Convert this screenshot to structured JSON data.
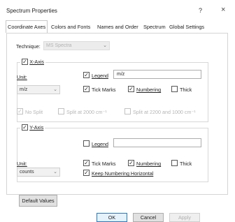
{
  "window": {
    "title": "Spectrum Properties",
    "help": "?",
    "close": "×"
  },
  "tabs": [
    "Coordinate Axes",
    "Colors and Fonts",
    "Names and Order",
    "Spectrum",
    "Global Settings"
  ],
  "technique": {
    "label": "Technique:",
    "value": "MS Spectra"
  },
  "x_axis": {
    "title": "X-Axis",
    "checked": true,
    "unit_label": "Unit:",
    "unit_value": "m/z",
    "legend_label": "Legend",
    "legend_value": "m/z",
    "tick_marks": "Tick Marks",
    "numbering": "Numbering",
    "thick": "Thick",
    "no_split": "No Split",
    "split_2000": "Split at 2000 cm⁻¹",
    "split_2200": "Split at 2200 and 1000 cm⁻¹"
  },
  "y_axis": {
    "title": "Y-Axis",
    "checked": true,
    "legend_label": "Legend",
    "legend_value": "",
    "unit_label": "Unit:",
    "unit_value": "counts",
    "tick_marks": "Tick Marks",
    "numbering": "Numbering",
    "thick": "Thick",
    "keep_horizontal": "Keep Numbering Horizontal"
  },
  "buttons": {
    "default_values": "Default Values",
    "ok": "OK",
    "cancel": "Cancel",
    "apply": "Apply"
  },
  "icons": {
    "check": "✓",
    "dropdown": "⌄"
  }
}
